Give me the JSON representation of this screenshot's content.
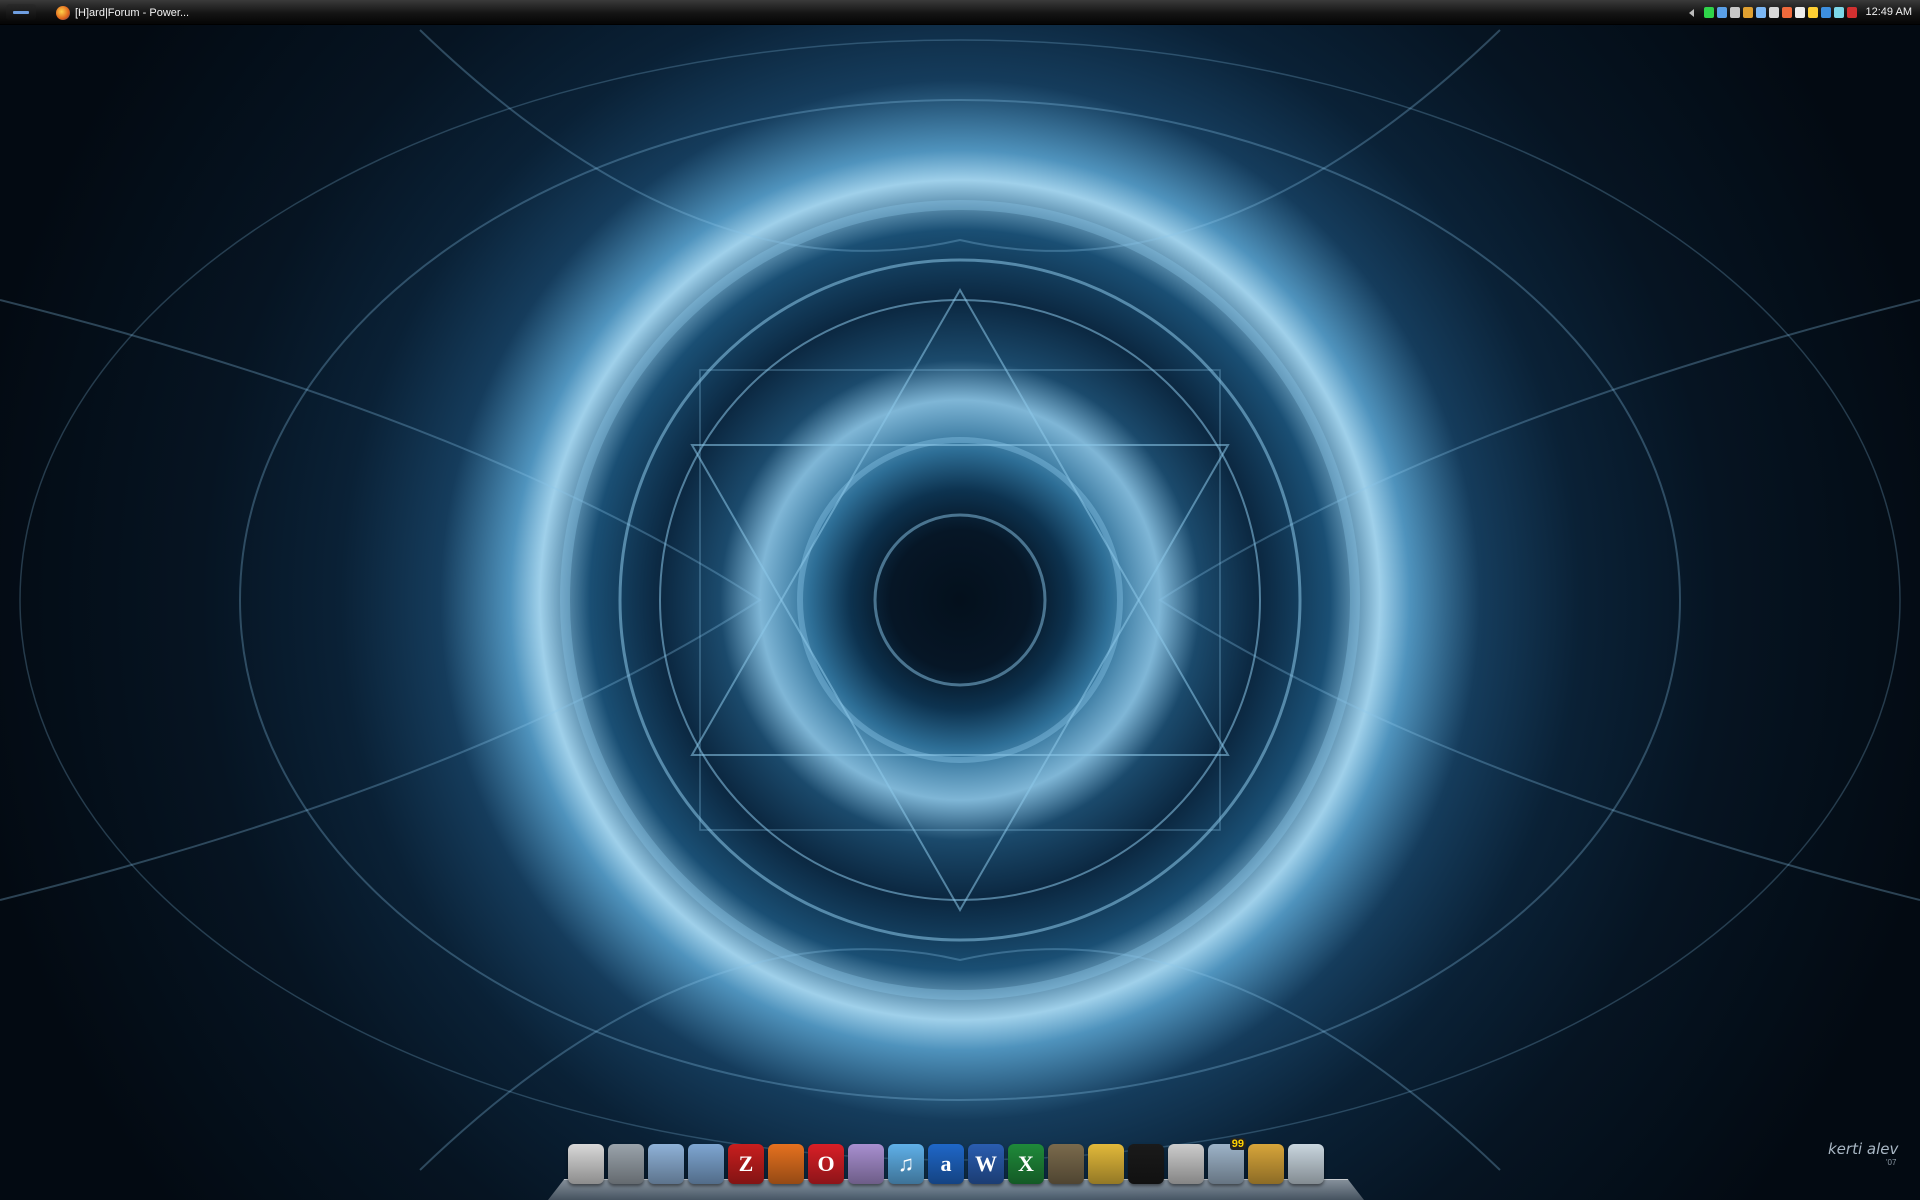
{
  "taskbar": {
    "window_title": "[H]ard|Forum - Power...",
    "clock": "12:49 AM",
    "tray_icons": [
      {
        "name": "green-status-icon",
        "color": "#2fd44a"
      },
      {
        "name": "network-icon",
        "color": "#5aa0e8"
      },
      {
        "name": "monitor-icon",
        "color": "#c8c8c8"
      },
      {
        "name": "sync-icon",
        "color": "#e0a030"
      },
      {
        "name": "chat-icon",
        "color": "#7bb7f5"
      },
      {
        "name": "music-icon",
        "color": "#d9d9d9"
      },
      {
        "name": "color-icon",
        "color": "#f06a3c"
      },
      {
        "name": "volume-icon",
        "color": "#ececec"
      },
      {
        "name": "star-icon",
        "color": "#ffcf33"
      },
      {
        "name": "bluetooth-icon",
        "color": "#3d8fe0"
      },
      {
        "name": "update-icon",
        "color": "#7cd7e8"
      },
      {
        "name": "shield-icon",
        "color": "#d23030"
      }
    ]
  },
  "dock": {
    "icons": [
      {
        "name": "file-manager-icon",
        "glyph": "",
        "color": "#d8d8d8"
      },
      {
        "name": "tools-icon",
        "glyph": "",
        "color": "#9aa3ab"
      },
      {
        "name": "documents-folder-icon",
        "glyph": "",
        "color": "#8fb2d8"
      },
      {
        "name": "applications-folder-icon",
        "glyph": "",
        "color": "#7ea6d2"
      },
      {
        "name": "filezilla-icon",
        "glyph": "Z",
        "color": "#c81e1e"
      },
      {
        "name": "firefox-icon",
        "glyph": "",
        "color": "#e5711f"
      },
      {
        "name": "opera-icon",
        "glyph": "O",
        "color": "#d81f26"
      },
      {
        "name": "pidgin-icon",
        "glyph": "",
        "color": "#a88fd0"
      },
      {
        "name": "itunes-icon",
        "glyph": "♫",
        "color": "#5fb0e8"
      },
      {
        "name": "aim-icon",
        "glyph": "a",
        "color": "#1f67c8"
      },
      {
        "name": "word-icon",
        "glyph": "W",
        "color": "#2a5db0"
      },
      {
        "name": "excel-icon",
        "glyph": "X",
        "color": "#1f8a3a"
      },
      {
        "name": "gimp-icon",
        "glyph": "",
        "color": "#7a6a4c"
      },
      {
        "name": "fallout-icon",
        "glyph": "",
        "color": "#e2b93a"
      },
      {
        "name": "steam-icon",
        "glyph": "",
        "color": "#1a1a1a"
      },
      {
        "name": "fan-icon",
        "glyph": "",
        "color": "#cccccc"
      },
      {
        "name": "monitor-icon",
        "glyph": "",
        "color": "#9db3c8",
        "badge": "99"
      },
      {
        "name": "hammer-icon",
        "glyph": "",
        "color": "#d7a53a"
      },
      {
        "name": "recycle-bin-icon",
        "glyph": "",
        "color": "#c9d6df"
      }
    ]
  },
  "wallpaper": {
    "signature": "kerti alev",
    "year": "'07"
  }
}
